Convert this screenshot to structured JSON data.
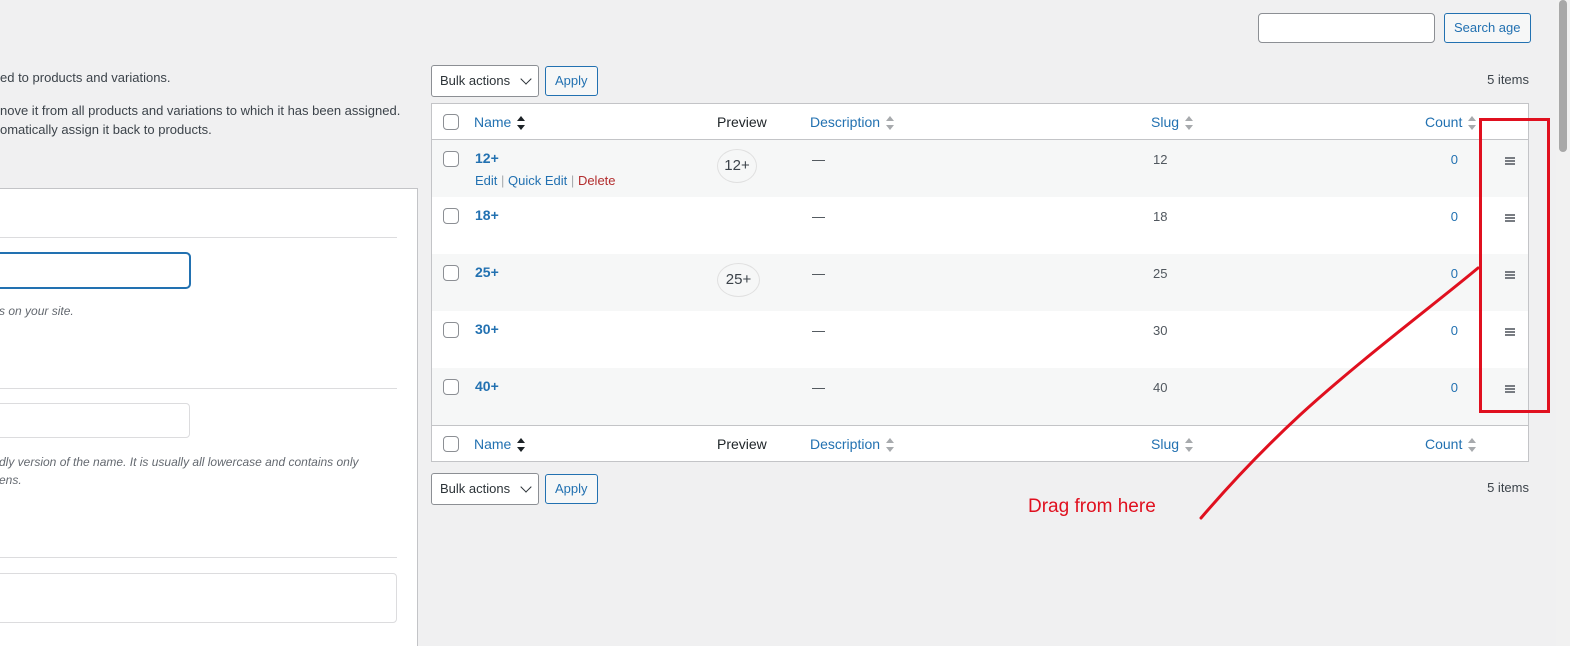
{
  "left": {
    "line1": "ed to products and variations.",
    "line2": "nove it from all products and variations to which it has been assigned.",
    "line3": "omatically assign it back to products.",
    "name_hint": "s on your site.",
    "slug_hint_1": "dly version of the name. It is usually all lowercase and contains only",
    "slug_hint_2": "ens."
  },
  "search": {
    "button_label": "Search age",
    "value": ""
  },
  "bulk_top": {
    "select_label": "Bulk actions",
    "apply_label": "Apply",
    "items_count": "5 items"
  },
  "bulk_bottom": {
    "select_label": "Bulk actions",
    "apply_label": "Apply",
    "items_count": "5 items"
  },
  "table": {
    "columns": {
      "name": "Name",
      "preview": "Preview",
      "description": "Description",
      "slug": "Slug",
      "count": "Count"
    },
    "row_actions": {
      "edit": "Edit",
      "sep": "|",
      "quick_edit": "Quick Edit",
      "delete": "Delete"
    },
    "rows": [
      {
        "name": "12+",
        "preview": "12+",
        "description": "—",
        "slug": "12",
        "count": "0"
      },
      {
        "name": "18+",
        "preview": "",
        "description": "—",
        "slug": "18",
        "count": "0"
      },
      {
        "name": "25+",
        "preview": "25+",
        "description": "—",
        "slug": "25",
        "count": "0"
      },
      {
        "name": "30+",
        "preview": "",
        "description": "—",
        "slug": "30",
        "count": "0"
      },
      {
        "name": "40+",
        "preview": "",
        "description": "—",
        "slug": "40",
        "count": "0"
      }
    ]
  },
  "annotation": {
    "text": "Drag from here",
    "color": "#e0101f"
  },
  "icons": {
    "drag_handle": "drag-handle-icon",
    "sort": "sort-arrows-icon",
    "chevron": "chevron-down-icon"
  }
}
